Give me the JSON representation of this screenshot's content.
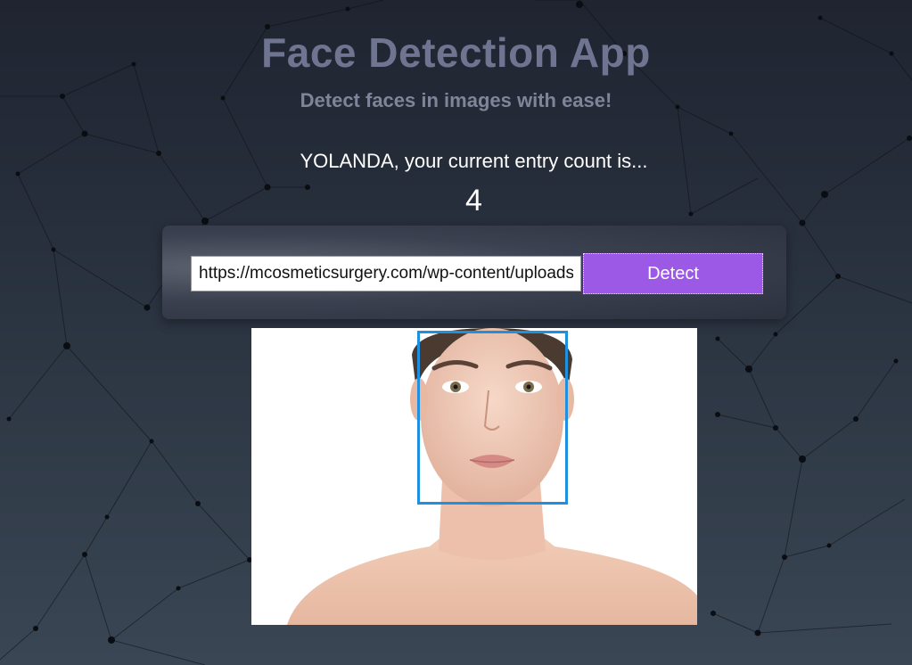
{
  "header": {
    "title": "Face Detection App",
    "subtitle": "Detect faces in images with ease!"
  },
  "rank": {
    "message": "YOLANDA, your current entry count is...",
    "count": "4"
  },
  "form": {
    "input_value": "https://mcosmeticsurgery.com/wp-content/uploads/face.jpg",
    "button_label": "Detect"
  },
  "colors": {
    "accent": "#9b59e6",
    "bounding_box": "#1f8fe0"
  }
}
